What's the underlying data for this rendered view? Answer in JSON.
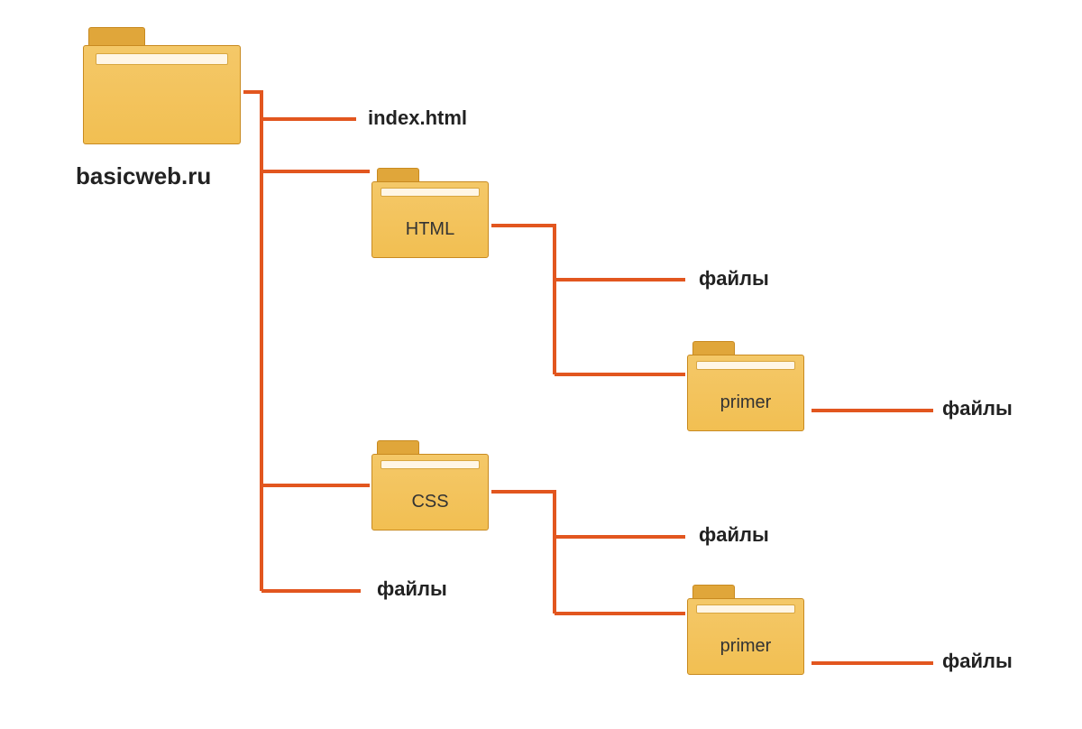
{
  "root": {
    "label": "basicweb.ru"
  },
  "children": {
    "index": "index.html",
    "html_folder": "HTML",
    "css_folder": "CSS",
    "root_files": "файлы"
  },
  "html_children": {
    "files": "файлы",
    "primer": "primer",
    "primer_files": "файлы"
  },
  "css_children": {
    "files": "файлы",
    "primer": "primer",
    "primer_files": "файлы"
  },
  "colors": {
    "connector": "#e2561f",
    "folder_fill": "#f3c25a",
    "folder_stroke": "#c88a20"
  }
}
